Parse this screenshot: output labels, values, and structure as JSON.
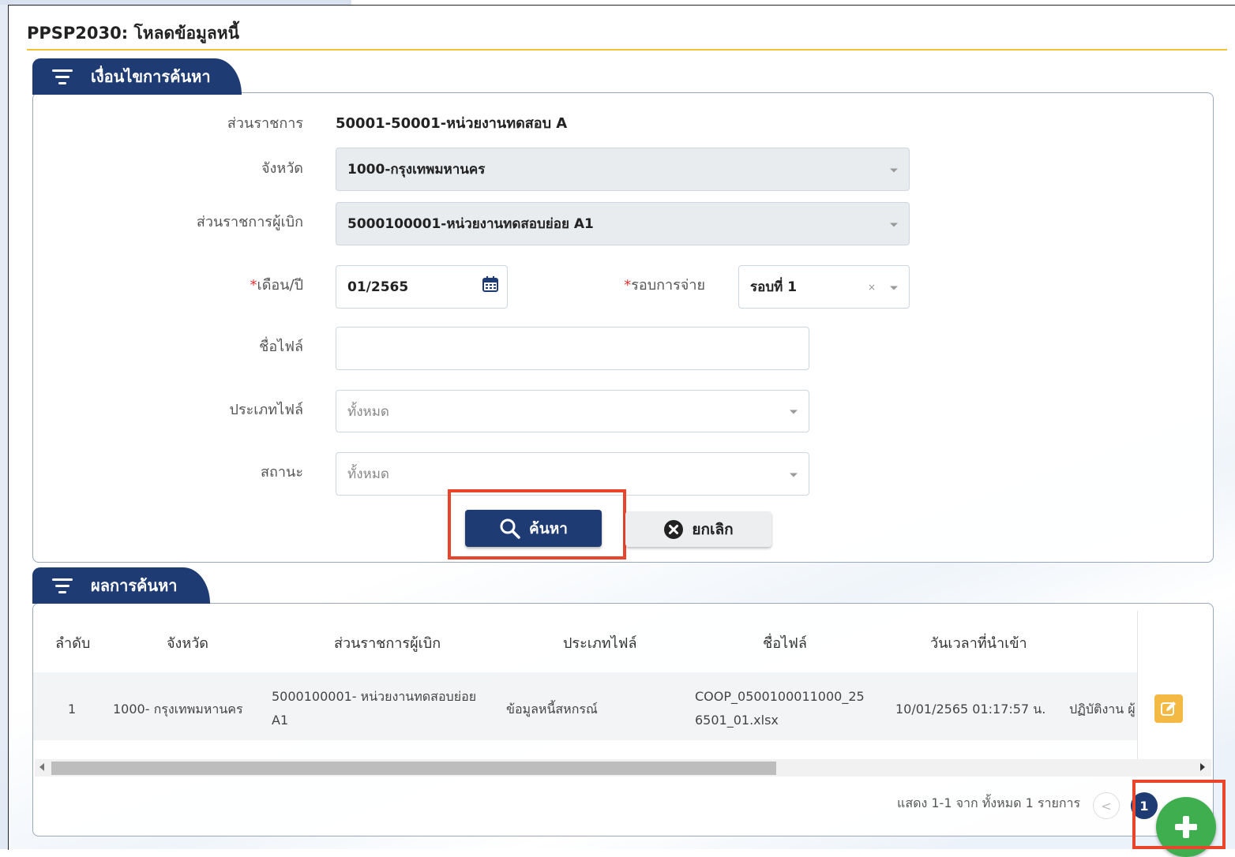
{
  "page": {
    "title": "PPSP2030: โหลดข้อมูลหนี้"
  },
  "search_panel": {
    "tab_label": "เงื่อนไขการค้นหา",
    "fields": {
      "department": {
        "label": "ส่วนราชการ",
        "value": "50001-50001-หน่วยงานทดสอบ A"
      },
      "province": {
        "label": "จังหวัด",
        "value": "1000-กรุงเทพมหานคร"
      },
      "issuing_unit": {
        "label": "ส่วนราชการผู้เบิก",
        "value": "5000100001-หน่วยงานทดสอบย่อย A1"
      },
      "month_year": {
        "required_mark": "*",
        "label": "เดือน/ปี",
        "value": "01/2565"
      },
      "payment_round": {
        "required_mark": "*",
        "label": "รอบการจ่าย",
        "value": "รอบที่ 1",
        "clear": "×"
      },
      "file_name": {
        "label": "ชื่อไฟล์",
        "value": ""
      },
      "file_type": {
        "label": "ประเภทไฟล์",
        "placeholder": "ทั้งหมด"
      },
      "status": {
        "label": "สถานะ",
        "placeholder": "ทั้งหมด"
      }
    },
    "buttons": {
      "search": "ค้นหา",
      "cancel": "ยกเลิก"
    }
  },
  "results_panel": {
    "tab_label": "ผลการค้นหา",
    "columns": [
      "ลำดับ",
      "จังหวัด",
      "ส่วนราชการผู้เบิก",
      "ประเภทไฟล์",
      "ชื่อไฟล์",
      "วันเวลาที่นำเข้า"
    ],
    "rows": [
      {
        "no": "1",
        "province": "1000- กรุงเทพมหานคร",
        "unit_line1": "5000100001- หน่วยงานทดสอบย่อย",
        "unit_line2": "A1",
        "file_type": "ข้อมูลหนี้สหกรณ์",
        "file_line1": "COOP_0500100011000_25",
        "file_line2": "6501_01.xlsx",
        "imported_at": "10/01/2565 01:17:57 น.",
        "status_partial": "ปฏิบัติงาน ผู้"
      }
    ],
    "pagination": {
      "info": "แสดง 1-1 จาก ทั้งหมด 1 รายการ",
      "prev": "<",
      "current_page": "1"
    }
  },
  "colors": {
    "primary": "#1f3b73",
    "accent": "#f2c230",
    "highlight": "#e8452c",
    "fab": "#3fae4f",
    "edit": "#f4b942"
  },
  "icons": [
    "filter-icon",
    "calendar-icon",
    "search-icon",
    "close-circle-icon",
    "edit-icon",
    "plus-icon",
    "chevron-down-icon"
  ]
}
